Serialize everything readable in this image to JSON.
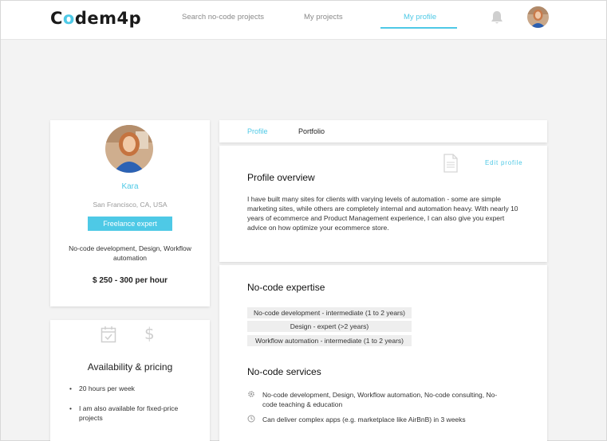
{
  "header": {
    "logo_prefix": "C",
    "logo_o": "o",
    "logo_suffix": "dem4p",
    "nav": [
      "Search no-code projects",
      "My projects",
      "My profile"
    ],
    "active_nav": "My profile",
    "bell_icon": "bell-icon",
    "accent": "#4ec9e6"
  },
  "profile": {
    "name": "Kara",
    "location": "San Francisco, CA, USA",
    "badge": "Freelance expert",
    "skills": "No-code development, Design, Workflow automation",
    "rate": "$ 250  -  300 per hour"
  },
  "availability": {
    "title": "Availability & pricing",
    "items": [
      "20 hours per week",
      "I am also available for fixed-price projects"
    ]
  },
  "tabs": [
    "Profile",
    "Portfolio"
  ],
  "overview": {
    "edit_label": "Edit profile",
    "title": "Profile overview",
    "text": "I have built many sites for clients with varying levels of automation - some are simple marketing sites, while others are completely internal and automation heavy. With nearly 10 years of ecommerce and Product Management experience, I can also give you expert advice on how optimize your ecommerce store."
  },
  "expertise": {
    "title": "No-code expertise",
    "items": [
      "No-code development - intermediate (1 to 2 years)",
      "Design - expert (>2 years)",
      "Workflow automation - intermediate (1 to 2 years)"
    ]
  },
  "services": {
    "title": "No-code services",
    "items": [
      {
        "icon": "gear-icon",
        "text": "No-code development, Design, Workflow automation, No-code consulting, No-code teaching & education"
      },
      {
        "icon": "clock-icon",
        "text": "Can deliver complex apps (e.g. marketplace like AirBnB) in 3 weeks"
      }
    ]
  }
}
